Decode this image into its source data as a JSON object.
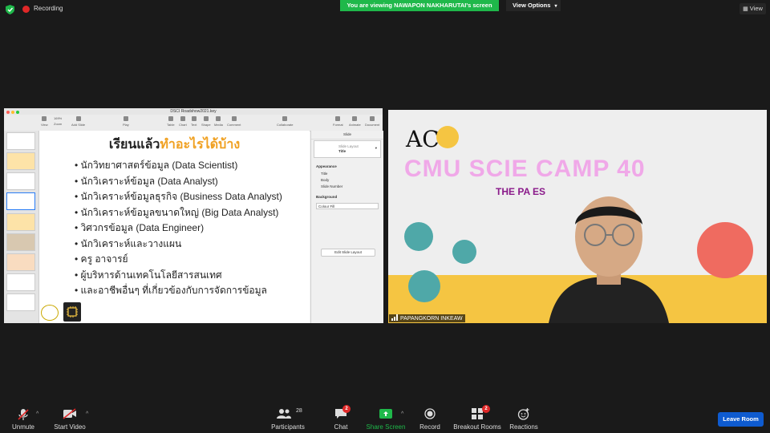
{
  "topbar": {
    "recording_label": "Recording",
    "viewing_banner": "You are viewing NAWAPON NAKHARUTAI's screen",
    "view_options_label": "View Options",
    "view_button_label": "View",
    "icons": [
      "shield-icon",
      "record-icon",
      "chevron-down-icon",
      "grid-icon"
    ]
  },
  "shared_screen": {
    "window_title": "DSCI Roadshow2021.key",
    "toolbar": {
      "zoom_value": "169%",
      "items": [
        "View",
        "Zoom",
        "Add Slide",
        "Play",
        "Table",
        "Chart",
        "Text",
        "Shape",
        "Media",
        "Comment",
        "Collaborate",
        "Format",
        "Animate",
        "Document"
      ]
    },
    "slide": {
      "title_prefix": "เรียนแล้ว",
      "title_highlight": "ทำอะไรได้บ้าง",
      "bullets": [
        "นักวิทยาศาสตร์ข้อมูล (Data Scientist)",
        "นักวิเคราะห์ข้อมูล (Data Analyst)",
        "นักวิเคราะห์ข้อมูลธุรกิจ (Business Data Analyst)",
        "นักวิเคราะห์ข้อมูลขนาดใหญ่ (Big Data Analyst)",
        "วิศวกรข้อมูล (Data Engineer)",
        "นักวิเคราะห์และวางแผน",
        "ครู อาจารย์",
        "ผู้บริหารด้านเทคโนโลยีสารสนเทศ",
        "และอาชีพอื่นๆ ที่เกี่ยวข้องกับการจัดการข้อมูล"
      ]
    },
    "inspector": {
      "tab": "Slide",
      "layout_label": "Slide Layout",
      "layout_value": "Title",
      "appearance_heading": "Appearance",
      "options": [
        "Title",
        "Body",
        "Slide Number"
      ],
      "background_heading": "Background",
      "fill_value": "Colour Fill",
      "edit_layout_button": "Edit Slide Layout"
    },
    "colors": {
      "selection": "#2a7df5",
      "title_highlight": "#f0a020"
    }
  },
  "video": {
    "participant_name": "PAPANGKORN INKEAW",
    "background_title": "CMU SCIE      CAMP 40",
    "background_subtitle": "THE PA             ES",
    "logo_text": "AC",
    "colors": {
      "title": "#f0a8e8",
      "subtitle": "#8a1a8a",
      "accent": "#f5c542"
    }
  },
  "bottombar": {
    "unmute": {
      "label": "Unmute",
      "icon": "microphone-muted-icon"
    },
    "start_video": {
      "label": "Start Video",
      "icon": "video-off-icon"
    },
    "participants": {
      "label": "Participants",
      "count": "28",
      "icon": "people-icon"
    },
    "chat": {
      "label": "Chat",
      "badge": "2",
      "icon": "chat-icon"
    },
    "share_screen": {
      "label": "Share Screen",
      "icon": "share-screen-icon"
    },
    "record": {
      "label": "Record",
      "icon": "record-icon"
    },
    "breakout_rooms": {
      "label": "Breakout Rooms",
      "badge": "2",
      "icon": "breakout-rooms-icon"
    },
    "reactions": {
      "label": "Reactions",
      "icon": "smile-plus-icon"
    },
    "leave_button": "Leave Room",
    "colors": {
      "share_screen": "#1fb84a",
      "leave": "#0e5bd0",
      "badge": "#e02828"
    }
  }
}
